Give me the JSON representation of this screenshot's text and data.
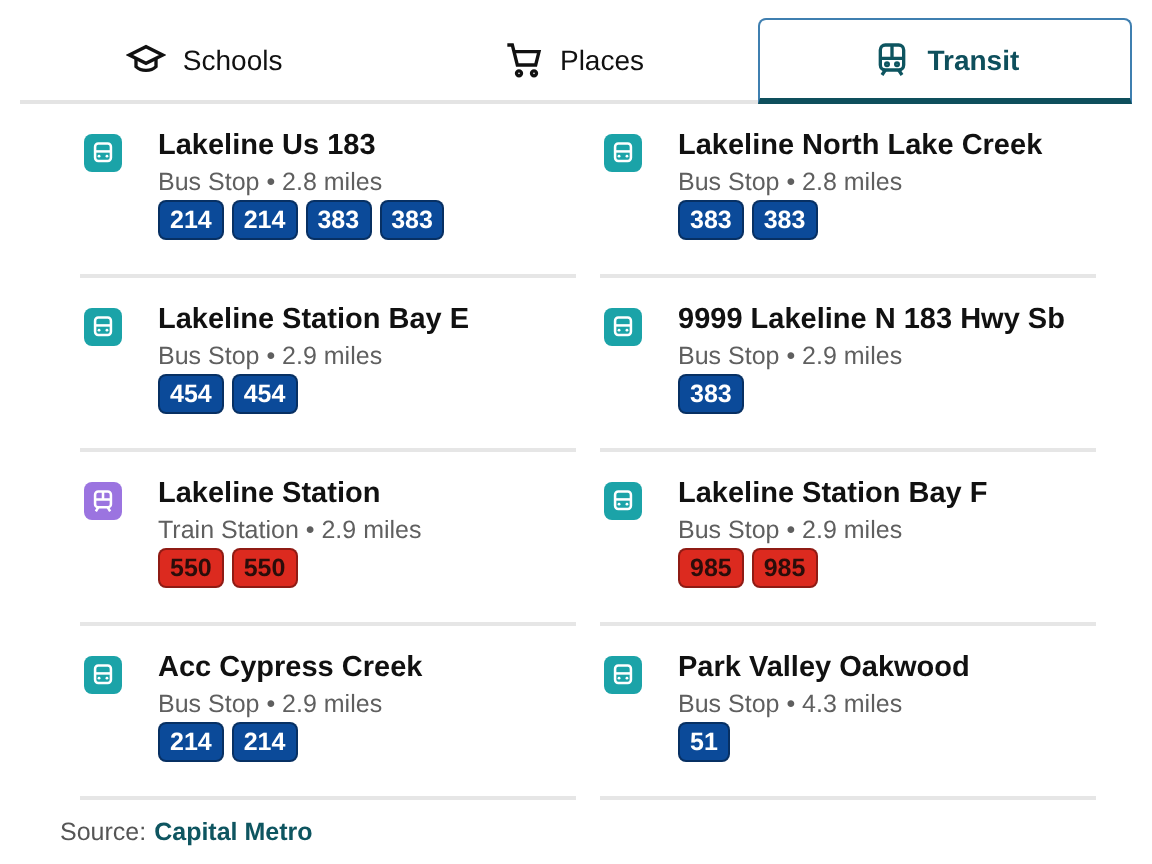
{
  "tabs": [
    {
      "label": "Schools",
      "kind": "school",
      "selected": false
    },
    {
      "label": "Places",
      "kind": "cart",
      "selected": false
    },
    {
      "label": "Transit",
      "kind": "train",
      "selected": true
    }
  ],
  "stops": [
    {
      "name": "Lakeline Us 183",
      "kind": "bus",
      "detail": "Bus Stop • 2.8 miles",
      "routes": [
        {
          "label": "214",
          "color": "#0b4a99"
        },
        {
          "label": "214",
          "color": "#0b4a99"
        },
        {
          "label": "383",
          "color": "#0b4a99"
        },
        {
          "label": "383",
          "color": "#0b4a99"
        }
      ]
    },
    {
      "name": "Lakeline North Lake Creek",
      "kind": "bus",
      "detail": "Bus Stop • 2.8 miles",
      "routes": [
        {
          "label": "383",
          "color": "#0b4a99"
        },
        {
          "label": "383",
          "color": "#0b4a99"
        }
      ]
    },
    {
      "name": "Lakeline Station Bay E",
      "kind": "bus",
      "detail": "Bus Stop • 2.9 miles",
      "routes": [
        {
          "label": "454",
          "color": "#0b4a99"
        },
        {
          "label": "454",
          "color": "#0b4a99"
        }
      ]
    },
    {
      "name": "9999 Lakeline N 183 Hwy Sb",
      "kind": "bus",
      "detail": "Bus Stop • 2.9 miles",
      "routes": [
        {
          "label": "383",
          "color": "#0b4a99"
        }
      ]
    },
    {
      "name": "Lakeline Station",
      "kind": "train",
      "detail": "Train Station • 2.9 miles",
      "routes": [
        {
          "label": "550",
          "color": "#dc2a1f"
        },
        {
          "label": "550",
          "color": "#dc2a1f"
        }
      ]
    },
    {
      "name": "Lakeline Station Bay F",
      "kind": "bus",
      "detail": "Bus Stop • 2.9 miles",
      "routes": [
        {
          "label": "985",
          "color": "#dc2a1f"
        },
        {
          "label": "985",
          "color": "#dc2a1f"
        }
      ]
    },
    {
      "name": "Acc Cypress Creek",
      "kind": "bus",
      "detail": "Bus Stop • 2.9 miles",
      "routes": [
        {
          "label": "214",
          "color": "#0b4a99"
        },
        {
          "label": "214",
          "color": "#0b4a99"
        }
      ]
    },
    {
      "name": "Park Valley Oakwood",
      "kind": "bus",
      "detail": "Bus Stop • 4.3 miles",
      "routes": [
        {
          "label": "51",
          "color": "#0b4a99"
        }
      ]
    }
  ],
  "source": {
    "label": "Source:",
    "link": "Capital Metro"
  }
}
